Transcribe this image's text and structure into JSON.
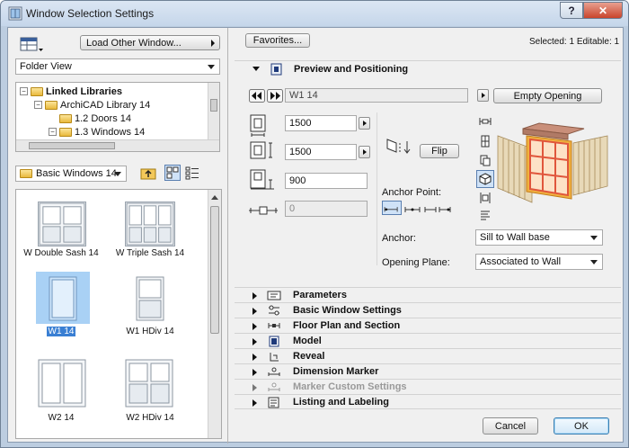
{
  "window": {
    "title": "Window Selection Settings",
    "help": "?",
    "close": "✕"
  },
  "left": {
    "load_other": "Load Other Window...",
    "view_mode": "Folder View",
    "tree": [
      {
        "label": "Linked Libraries",
        "bold": true
      },
      {
        "label": "ArchiCAD Library 14"
      },
      {
        "label": "1.2 Doors 14"
      },
      {
        "label": "1.3 Windows 14"
      }
    ],
    "folder": "Basic Windows 14",
    "gallery": [
      {
        "label": "W Double Sash 14"
      },
      {
        "label": "W Triple Sash 14"
      },
      {
        "label": "W1 14",
        "selected": true
      },
      {
        "label": "W1 HDiv 14"
      },
      {
        "label": "W2 14"
      },
      {
        "label": "W2 HDiv 14"
      }
    ]
  },
  "right": {
    "favorites": "Favorites...",
    "status": "Selected: 1 Editable: 1",
    "preview_title": "Preview and Positioning",
    "name_field": "W1 14",
    "empty_opening": "Empty Opening",
    "width": "1500",
    "height": "1500",
    "sill": "900",
    "offset": "0",
    "flip": "Flip",
    "anchor_point": "Anchor Point:",
    "anchor_label": "Anchor:",
    "anchor_value": "Sill to Wall base",
    "plane_label": "Opening Plane:",
    "plane_value": "Associated to Wall",
    "sections": [
      {
        "label": "Parameters",
        "icon": "parameters-icon",
        "disabled": false
      },
      {
        "label": "Basic Window Settings",
        "icon": "settings-icon",
        "disabled": false
      },
      {
        "label": "Floor Plan and Section",
        "icon": "floorplan-icon",
        "disabled": false
      },
      {
        "label": "Model",
        "icon": "model-icon",
        "disabled": false
      },
      {
        "label": "Reveal",
        "icon": "reveal-icon",
        "disabled": false
      },
      {
        "label": "Dimension Marker",
        "icon": "dimension-icon",
        "disabled": false
      },
      {
        "label": "Marker Custom Settings",
        "icon": "marker-icon",
        "disabled": true
      },
      {
        "label": "Listing and Labeling",
        "icon": "listing-icon",
        "disabled": false
      }
    ],
    "cancel": "Cancel",
    "ok": "OK"
  }
}
